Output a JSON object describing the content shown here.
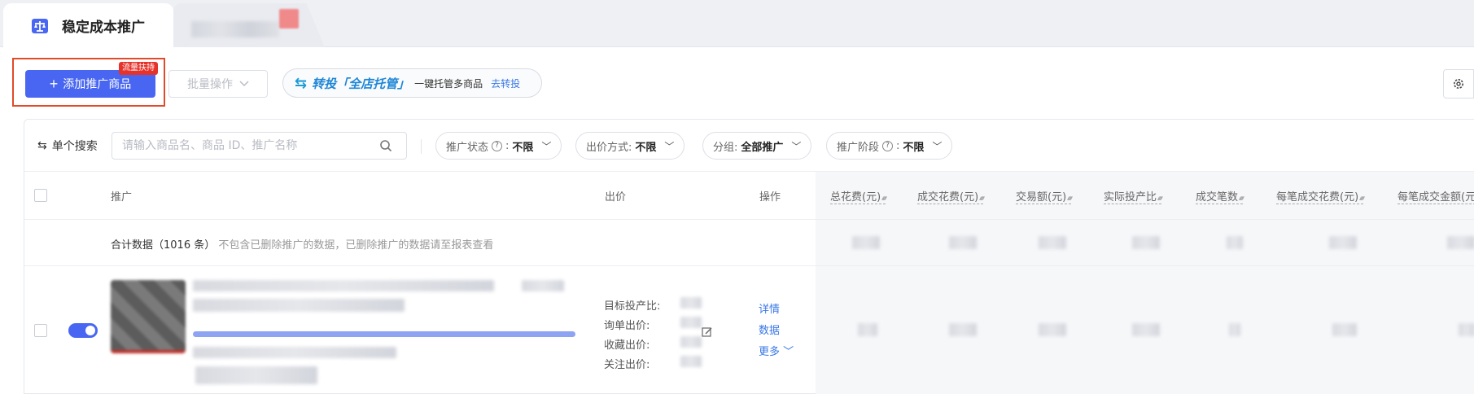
{
  "tabs": [
    {
      "label": "稳定成本推广",
      "active": true
    },
    {
      "label": "",
      "active": false
    }
  ],
  "toolbar": {
    "add_label": "添加推广商品",
    "add_badge": "流量扶持",
    "batch_label": "批量操作",
    "promo_title": "转投「全店托管」",
    "promo_sub": "一键托管多商品",
    "promo_link": "去转投"
  },
  "filters": {
    "search_label": "单个搜索",
    "search_placeholder": "请输入商品名、商品 ID、推广名称",
    "status_label": "推广状态",
    "status_value": "不限",
    "bid_label": "出价方式:",
    "bid_value": "不限",
    "group_label": "分组:",
    "group_value": "全部推广",
    "stage_label": "推广阶段",
    "stage_value": "不限"
  },
  "table": {
    "headers": {
      "promo": "推广",
      "bid": "出价",
      "ops": "操作",
      "total_cost": "总花费(元)",
      "deal_cost": "成交花费(元)",
      "gmv": "交易额(元)",
      "roi": "实际投产比",
      "orders": "成交笔数",
      "cost_per_order": "每笔成交花费(元)",
      "amount_per_order": "每笔成交金额(元)"
    },
    "total_label": "合计数据（1016 条）",
    "total_note": "不包含已删除推广的数据，已删除推广的数据请至报表查看",
    "row": {
      "enabled": true,
      "bid_target": "目标投产比:",
      "bid_inquiry": "询单出价:",
      "bid_favorite": "收藏出价:",
      "bid_follow": "关注出价:",
      "op_detail": "详情",
      "op_data": "数据",
      "op_more": "更多"
    }
  },
  "colors": {
    "primary": "#4866f2",
    "badge": "#e6322a",
    "highlight_frame": "#e14a2a",
    "link": "#3a78e6"
  }
}
